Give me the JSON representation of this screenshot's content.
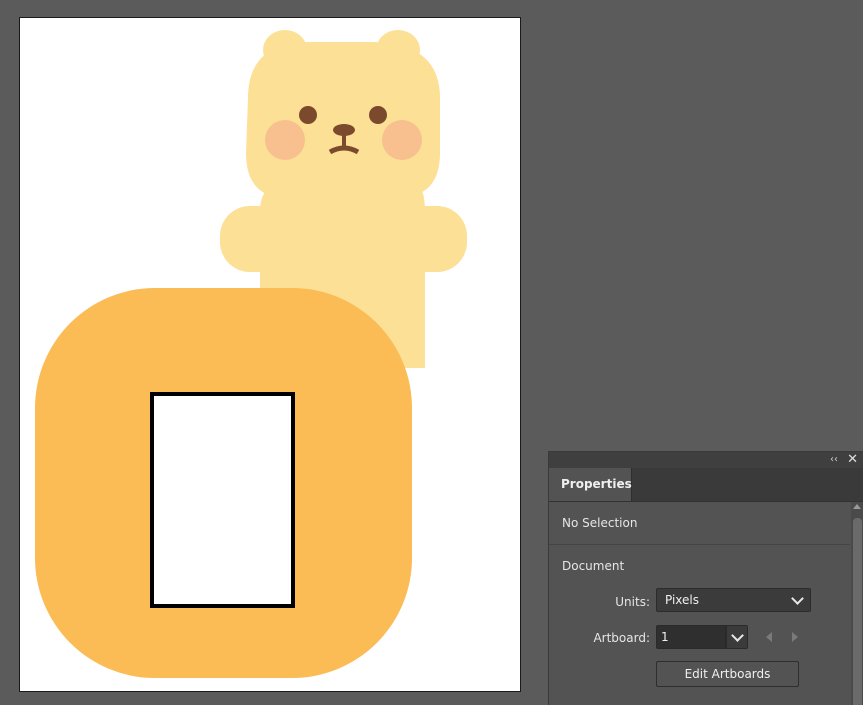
{
  "panel": {
    "collapse_icon": "‹‹",
    "close_icon": "✕",
    "tab_label": "Properties",
    "no_selection": "No Selection",
    "section_title": "Document",
    "units_label": "Units:",
    "units_value": "Pixels",
    "artboard_label": "Artboard:",
    "artboard_value": "1",
    "edit_button": "Edit Artboards"
  },
  "colors": {
    "canvas_bg": "#5b5b5b",
    "artboard_bg": "#ffffff",
    "bear_fill": "#fce096",
    "bear_cheek": "#f8c08f",
    "bear_feature": "#7b4a2d",
    "rounded_square_fill": "#fbbb55",
    "rectangle_stroke": "#000000"
  },
  "artwork": {
    "objects": [
      "bear-illustration",
      "rounded-square-shape",
      "white-rectangle"
    ]
  }
}
